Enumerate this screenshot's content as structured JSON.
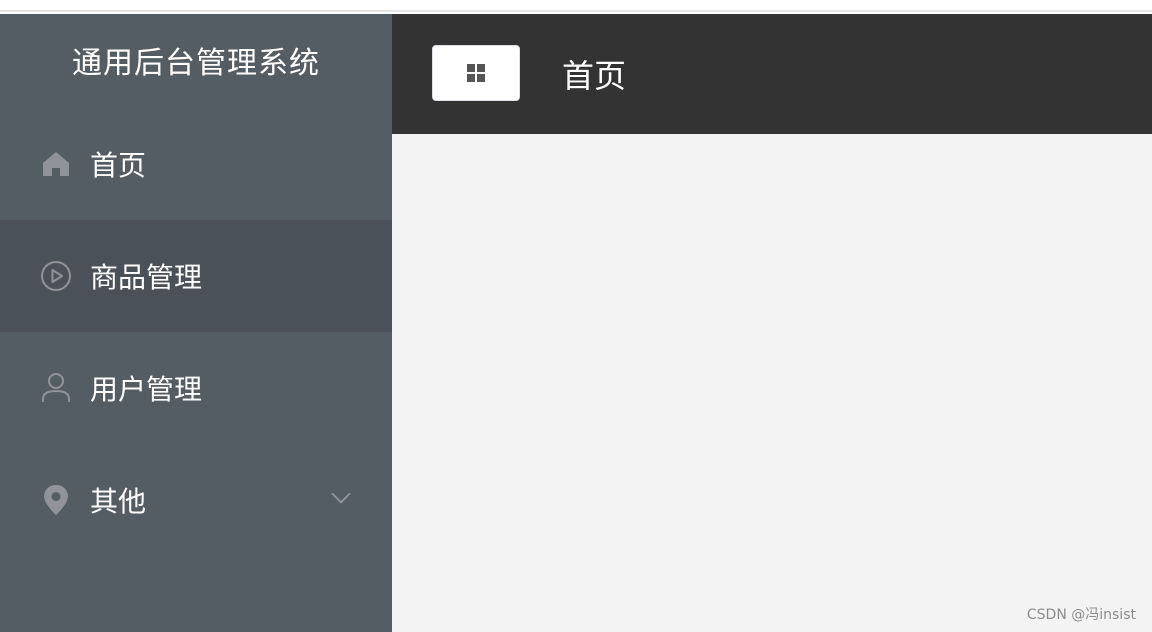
{
  "sidebar": {
    "title": "通用后台管理系统",
    "items": [
      {
        "label": "首页",
        "icon": "home-icon"
      },
      {
        "label": "商品管理",
        "icon": "video-play-icon"
      },
      {
        "label": "用户管理",
        "icon": "user-icon"
      },
      {
        "label": "其他",
        "icon": "location-icon"
      }
    ]
  },
  "header": {
    "title": "首页",
    "toggle_icon": "menu-grid-icon"
  },
  "watermark": "CSDN @冯insist",
  "colors": {
    "sidebar_bg": "#545c64",
    "sidebar_active_bg": "#4a5158",
    "header_bg": "#333333",
    "main_bg": "#f3f3f3",
    "icon_gray": "#909399"
  }
}
